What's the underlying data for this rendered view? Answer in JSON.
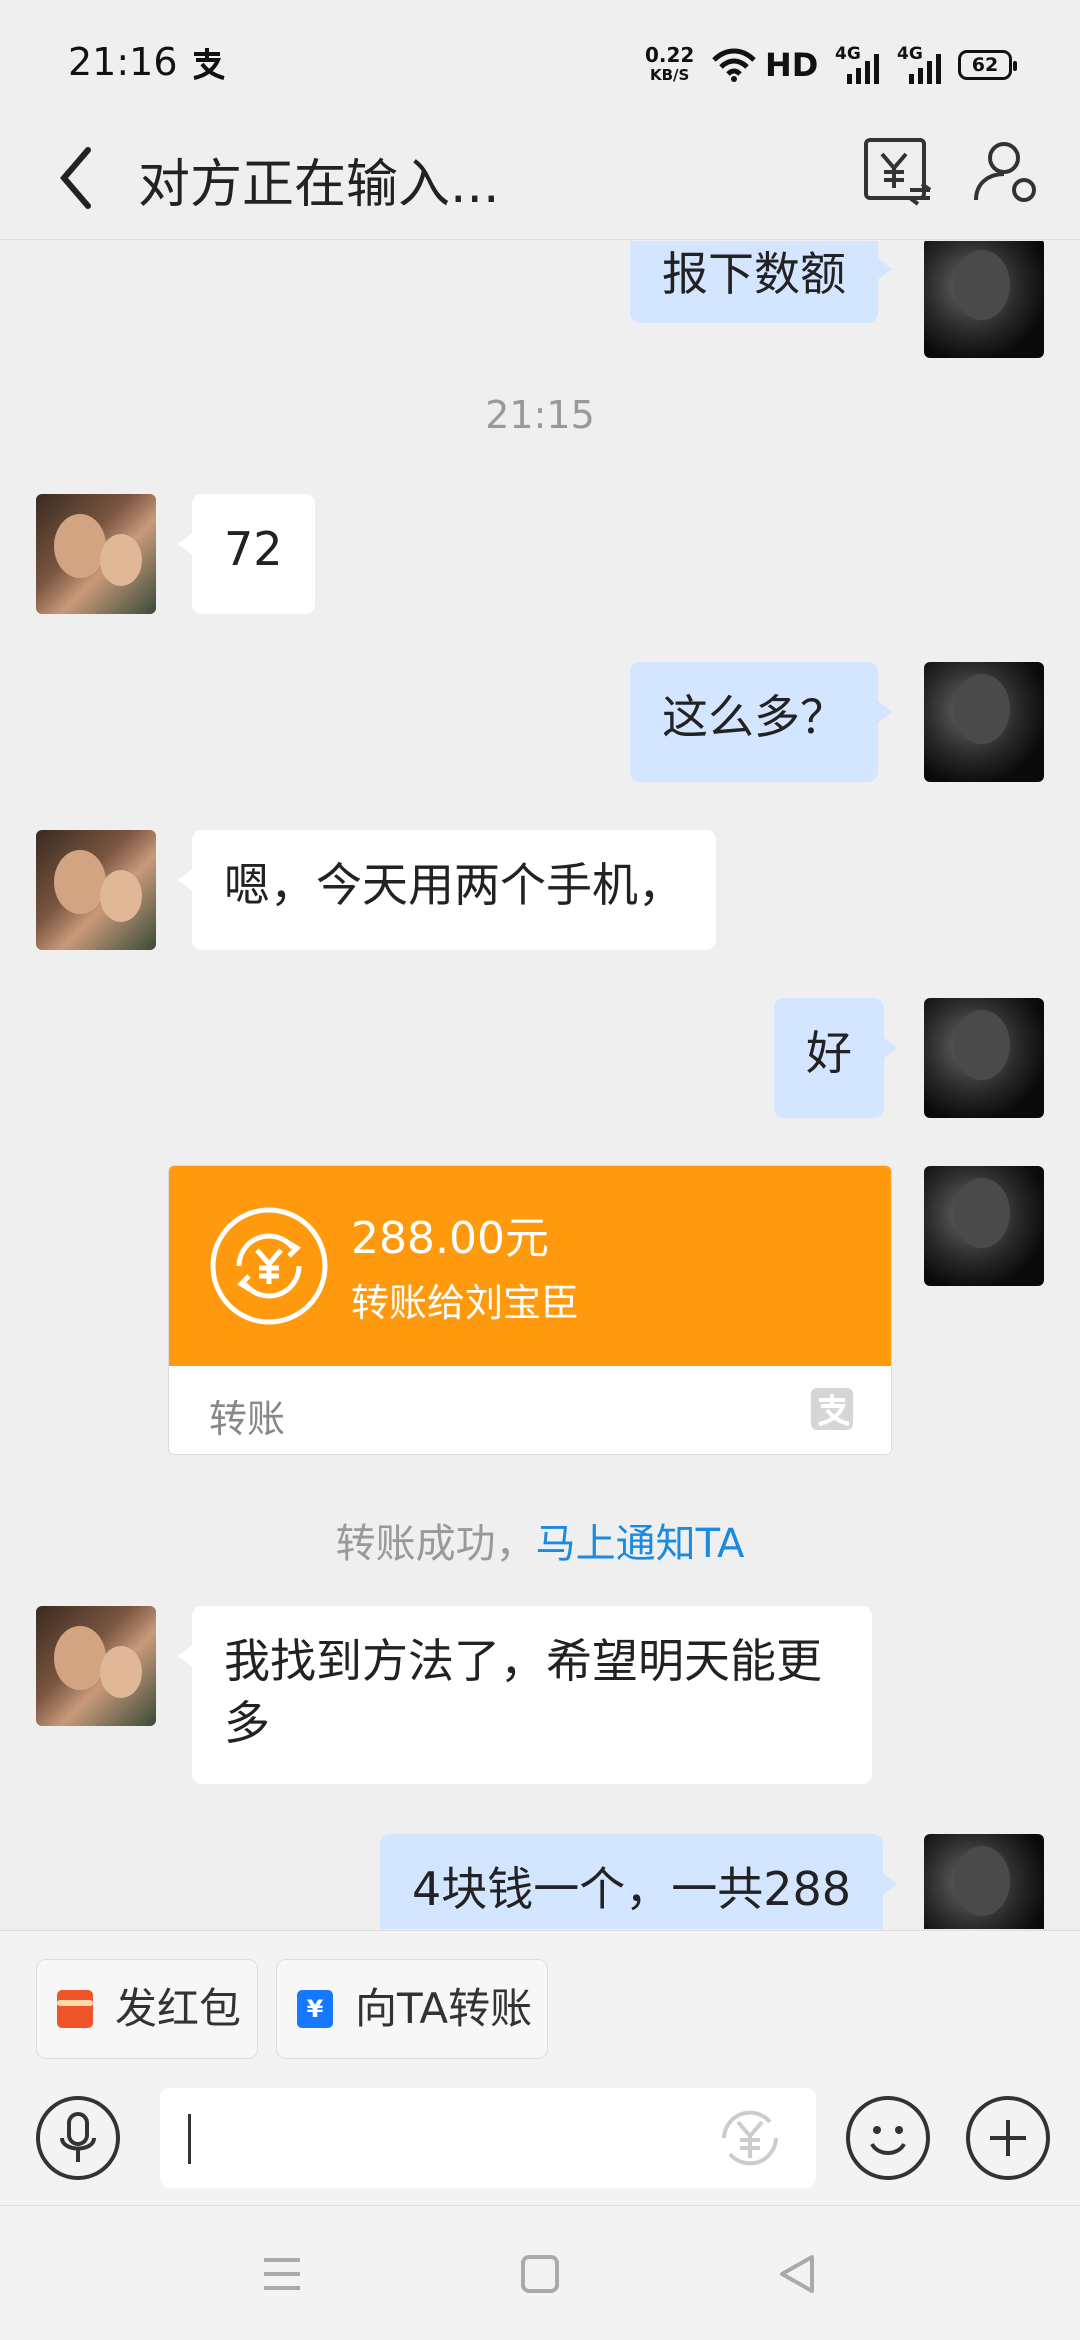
{
  "status_bar": {
    "time": "21:16",
    "net_speed": "0.22",
    "net_unit": "KB/S",
    "hd": "HD",
    "signal_1": "4G",
    "signal_2": "4G",
    "battery": "62"
  },
  "header": {
    "title": "对方正在输入..."
  },
  "chat": {
    "messages": [
      {
        "from": "me",
        "text": "报下数额"
      },
      {
        "timestamp": "21:15"
      },
      {
        "from": "them",
        "text": "72"
      },
      {
        "from": "me",
        "text": "这么多？"
      },
      {
        "from": "them",
        "text": "嗯，今天用两个手机，"
      },
      {
        "from": "me",
        "text": "好"
      },
      {
        "from": "them",
        "text": "我找到方法了，希望明天能更多"
      },
      {
        "from": "me",
        "text": "4块钱一个，一共288"
      }
    ],
    "transfer": {
      "amount": "288.00元",
      "to": "转账给刘宝臣",
      "label": "转账"
    },
    "transfer_notice": {
      "text": "转账成功，",
      "link": "马上通知TA"
    }
  },
  "quick_actions": {
    "red_packet": "发红包",
    "transfer_to": "向TA转账"
  },
  "colors": {
    "transfer_orange": "#ff9a0e",
    "my_bubble": "#d4e6ff",
    "link_blue": "#1a8be0",
    "red_packet": "#f0552a",
    "transfer_blue": "#1677ff"
  }
}
